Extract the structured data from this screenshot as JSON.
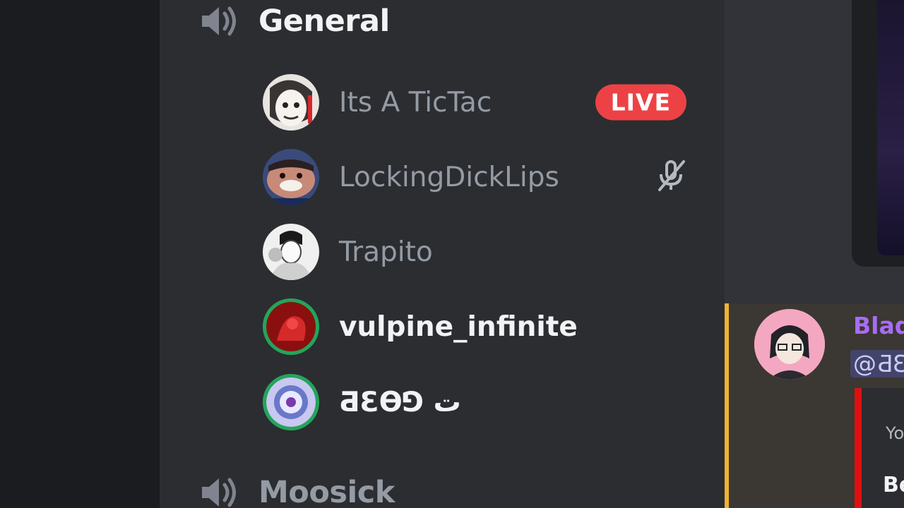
{
  "channels": [
    {
      "name": "General",
      "icon": "speaker-icon"
    },
    {
      "name": "Moosick",
      "icon": "speaker-icon"
    }
  ],
  "members": [
    {
      "name": "Its A TicTac",
      "badge": "LIVE",
      "speaking": false
    },
    {
      "name": "LockingDickLips",
      "status_icon": "mic-muted-icon",
      "speaking": false
    },
    {
      "name": "Trapito",
      "speaking": false
    },
    {
      "name": "vulpine_infinite",
      "speaking": true
    },
    {
      "name": "ƋƐƟ⅁ ت",
      "speaking": true
    }
  ],
  "message": {
    "author": "Blad",
    "mention": "@ƋƐ",
    "embed_line1": "Yo",
    "embed_line2": "Be"
  },
  "colors": {
    "live": "#ed4245",
    "speaking_ring": "#23a55a",
    "mention_bar": "#f0b232",
    "author": "#a86cf5"
  }
}
